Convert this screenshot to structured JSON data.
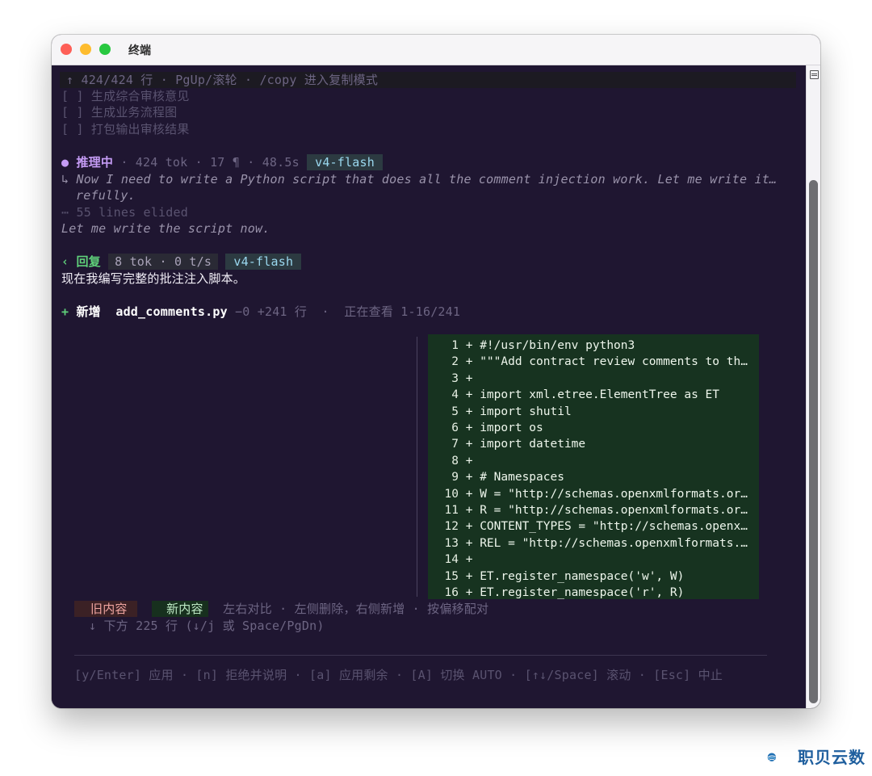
{
  "window": {
    "title": "终端"
  },
  "status_bar": {
    "text": "↑ 424/424 行 · PgUp/滚轮 · /copy 进入复制模式"
  },
  "checklist": [
    "[ ] 生成综合审核意见",
    "[ ] 生成业务流程图",
    "[ ] 打包输出审核结果"
  ],
  "reasoning": {
    "bullet": "●",
    "label": "推理中",
    "meta": "· 424 tok · 17 ¶ · 48.5s",
    "model": "v4-flash",
    "arrow": "↳",
    "thought_line1": "Now I need to write a Python script that does all the comment injection work. Let me write it…",
    "thought_line2": "refully.",
    "elided": "⋯ 55 lines elided",
    "final": "Let me write the script now."
  },
  "reply": {
    "arrow": "‹",
    "label": "回复",
    "meta": "8 tok · 0 t/s",
    "model": "v4-flash",
    "text": "现在我编写完整的批注注入脚本。"
  },
  "file_op": {
    "plus": "+",
    "action": "新增",
    "filename": "add_comments.py",
    "stats": "−0 +241 行  ·  正在查看 1-16/241"
  },
  "diff_lines": [
    {
      "n": "1",
      "text": "+ #!/usr/bin/env python3"
    },
    {
      "n": "2",
      "text": "+ \"\"\"Add contract review comments to th…"
    },
    {
      "n": "3",
      "text": "+"
    },
    {
      "n": "4",
      "text": "+ import xml.etree.ElementTree as ET"
    },
    {
      "n": "5",
      "text": "+ import shutil"
    },
    {
      "n": "6",
      "text": "+ import os"
    },
    {
      "n": "7",
      "text": "+ import datetime"
    },
    {
      "n": "8",
      "text": "+"
    },
    {
      "n": "9",
      "text": "+ # Namespaces"
    },
    {
      "n": "10",
      "text": "+ W = \"http://schemas.openxmlformats.or…"
    },
    {
      "n": "11",
      "text": "+ R = \"http://schemas.openxmlformats.or…"
    },
    {
      "n": "12",
      "text": "+ CONTENT_TYPES = \"http://schemas.openx…"
    },
    {
      "n": "13",
      "text": "+ REL = \"http://schemas.openxmlformats.…"
    },
    {
      "n": "14",
      "text": "+"
    },
    {
      "n": "15",
      "text": "+ ET.register_namespace('w', W)"
    },
    {
      "n": "16",
      "text": "+ ET.register_namespace('r', R)"
    }
  ],
  "legend": {
    "old": "旧内容",
    "new": "新内容",
    "hint": "左右对比 · 左侧删除，右侧新增 · 按偏移配对"
  },
  "below": "↓ 下方 225 行 (↓/j 或 Space/PgDn)",
  "footer": "[y/Enter] 应用 · [n] 拒绝并说明 · [a] 应用剩余 · [A] 切换 AUTO · [↑↓/Space] 滚动 · [Esc] 中止",
  "watermark": {
    "text": "职贝云数"
  },
  "colors": {
    "terminal_bg": "#1f1631",
    "diff_add_bg": "#173320",
    "accent_purple": "#c59cf5",
    "accent_green": "#5fd07a",
    "badge_text": "#9ad8ef"
  }
}
